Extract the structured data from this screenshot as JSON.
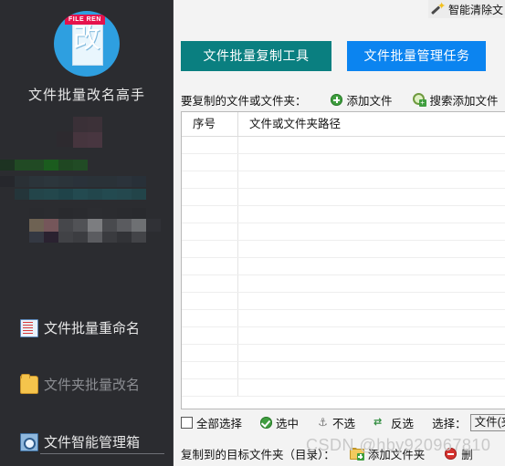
{
  "app": {
    "name": "文件批量改名高手",
    "logo_tag": "FILE REN",
    "logo_glyph": "改"
  },
  "colors": {
    "sidebar_bg": "#2b2c30",
    "tab_active": "#0a7f80",
    "tab_inactive": "#0b84f0",
    "accent_green": "#3f9e3f",
    "accent_red": "#d5322e",
    "logo_blue": "#2e9fe0",
    "logo_tag_red": "#e5124c"
  },
  "sidebar": {
    "items": [
      {
        "label": "文件批量重命名",
        "icon": "document-lines-icon",
        "state": "normal"
      },
      {
        "label": "文件夹批量改名",
        "icon": "folder-icon",
        "state": "dim"
      },
      {
        "label": "文件智能管理箱",
        "icon": "file-search-box-icon",
        "state": "selected"
      }
    ],
    "censored_note": "mosaic"
  },
  "topbar": {
    "smart_clear": {
      "label": "智能清除文",
      "icon": "magic-wand-icon"
    }
  },
  "tabs": [
    {
      "label": "文件批量复制工具",
      "active": true
    },
    {
      "label": "文件批量管理任务",
      "active": false
    }
  ],
  "source": {
    "label": "要复制的文件或文件夹：",
    "add_file": {
      "label": "添加文件",
      "icon": "plus-circle-icon"
    },
    "search_add": {
      "label": "搜索添加文件",
      "icon": "search-plus-icon"
    }
  },
  "table": {
    "columns": [
      "序号",
      "文件或文件夹路径"
    ],
    "rows": [],
    "empty_row_count": 15
  },
  "select_bar": {
    "select_all": "全部选择",
    "selected": {
      "label": "选中",
      "icon": "check-circle-icon"
    },
    "unselect": {
      "label": "不选",
      "icon": "anchor-icon"
    },
    "invert": {
      "label": "反选",
      "icon": "swap-icon"
    },
    "select_label": "选择：",
    "select_value": "文件(夹)"
  },
  "destination": {
    "label": "复制到的目标文件夹（目录）：",
    "add_folder": {
      "label": "添加文件夹",
      "icon": "folder-plus-icon"
    },
    "delete": {
      "label": "删",
      "icon": "minus-circle-icon"
    }
  },
  "watermark": "CSDN @hby920967810"
}
